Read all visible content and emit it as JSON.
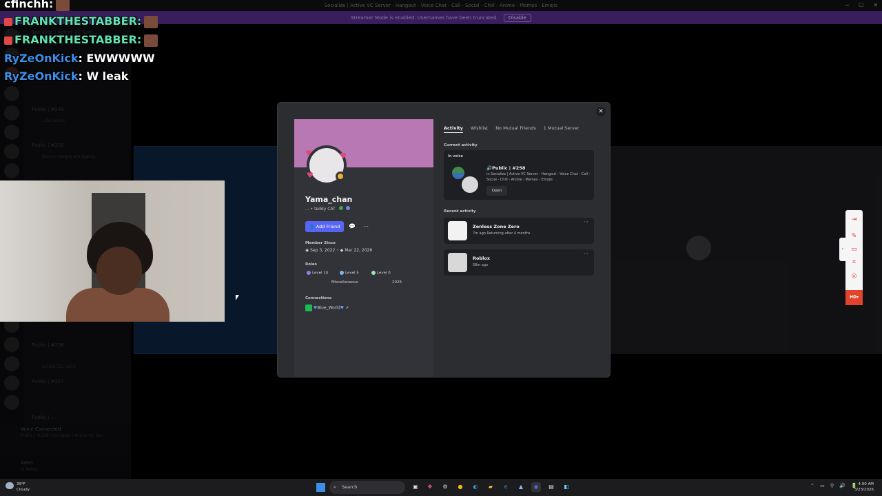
{
  "window": {
    "title": "Socialize | Active VC Server - Hangout - Voice Chat - Call - Social - Chill - Anime - Memes - Emojis",
    "streamer_notice": "Streamer Mode is enabled. Usernames have been truncated.",
    "disable_label": "Disable"
  },
  "chat_overlay": {
    "lines": [
      {
        "name": "cfinchh:",
        "msg": "",
        "name_color": "#ffffff"
      },
      {
        "name": "FRANKTHESTABBER:",
        "msg": "",
        "name_color": "#5fe3b3"
      },
      {
        "name": "FRANKTHESTABBER:",
        "msg": "",
        "name_color": "#5fe3b3"
      },
      {
        "name": "RyZeOnKick",
        "msg": ": EWWWWW",
        "name_color": "#3d8ee8"
      },
      {
        "name": "RyZeOnKick",
        "msg": ": W leak",
        "name_color": "#3d8ee8"
      }
    ]
  },
  "sidebar": {
    "server_header": "Socialize | Active VC Serv...",
    "channels": [
      {
        "name": "Public | #249",
        "sub": "...Tai Zonos"
      },
      {
        "name": "Public | #250",
        "sub": "Several people are typing..."
      },
      {
        "name": "Public | #256",
        "sub": "SoHOSTED DATE"
      },
      {
        "name": "Public | #257",
        "sub": ""
      },
      {
        "name": "Public | ...",
        "sub": "NEW UNREADS"
      }
    ],
    "voice_status": "Voice Connected",
    "voice_detail": "Public | #258 / Socialize | Active VC Ser...",
    "user_name": "Aden",
    "user_status": "In Voice"
  },
  "profile": {
    "username": "Yama_chan",
    "subline": "... • teddy  CAT",
    "add_friend_label": "Add Friend",
    "member_since_label": "Member Since",
    "member_since_discord": "Sep 3, 2022",
    "member_since_server": "Mar 22, 2026",
    "roles_label": "Roles",
    "roles": [
      {
        "label": "Level 10",
        "color": "#8f7fe0"
      },
      {
        "label": "Level 5",
        "color": "#7eb3e8"
      },
      {
        "label": "Level 0",
        "color": "#9fe3b5"
      },
      {
        "label": "Miscellaneous",
        "color": "#3a3c42"
      },
      {
        "label": "2026",
        "color": "#3a3c42"
      }
    ],
    "connections_label": "Connections",
    "connection_name": "Blue_World"
  },
  "tabs": [
    "Activity",
    "Wishlist",
    "No Mutual Friends",
    "1 Mutual Server"
  ],
  "activity": {
    "current_label": "Current activity",
    "in_voice_label": "In voice",
    "vc_title": "Public | #258",
    "vc_desc": "in Socialize | Active VC Server - Hangout - Voice Chat - Call - Social - Chill - Anime - Memes - Emojis",
    "open_label": "Open",
    "recent_label": "Recent activity",
    "games": [
      {
        "title": "Zenless Zone Zero",
        "meta": "7m ago   Returning after 4 months"
      },
      {
        "title": "Roblox",
        "meta": "58m ago"
      }
    ]
  },
  "overlay_tools": {
    "hd_label": "HD"
  },
  "taskbar": {
    "temperature": "39°F",
    "weather": "Cloudy",
    "search_label": "Search",
    "time": "4:00 AM",
    "date": "3/23/2026"
  }
}
